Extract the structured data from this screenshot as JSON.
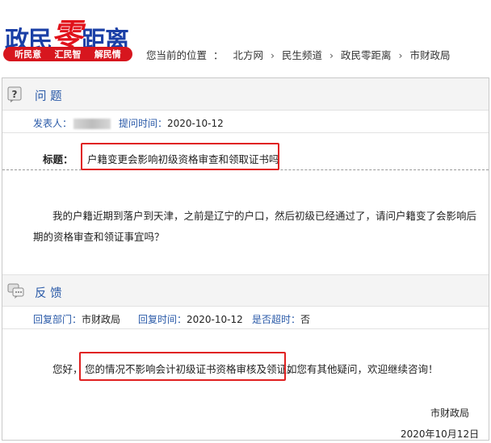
{
  "brand": {
    "logo_main_left": "政民",
    "logo_main_zero": "零",
    "logo_main_right": "距离",
    "tagline_items": [
      "听民意",
      "汇民智",
      "解民情"
    ]
  },
  "breadcrumb": {
    "label": "您当前的位置",
    "colon": "：",
    "items": [
      "北方网",
      "民生频道",
      "政民零距离",
      "市财政局"
    ],
    "separator": "›"
  },
  "question": {
    "section_title": "问 题",
    "section_icon": "question-mark-icon",
    "asker_label": "发表人：",
    "time_label": "提问时间：",
    "time_value": "2020-10-12",
    "title_label": "标题：",
    "title_text": "户籍变更会影响初级资格审查和领取证书吗",
    "body_line1": "我的户籍近期到落户到天津，之前是辽宁的户口，然后初级已经通过了，请问户籍变了会影响后",
    "body_line2": "期的资格审查和领证事宜吗？"
  },
  "reply": {
    "section_title": "反 馈",
    "section_icon": "speech-bubble-icon",
    "dept_label": "回复部门：",
    "dept_value": "市财政局",
    "time_label": "回复时间：",
    "time_value": "2020-10-12",
    "overtime_label": "是否超时：",
    "overtime_value": "否",
    "body_prefix": "您好，",
    "body_highlight": "您的情况不影响会计初级证书资格审核及领证。",
    "body_suffix": "如您有其他疑问，欢迎继续咨询！",
    "signature": "市财政局",
    "signature_date": "2020年10月12日"
  },
  "colors": {
    "brand_blue": "#1a3fa6",
    "brand_red": "#e1121b",
    "link_blue": "#2a5aa8",
    "highlight_border": "#e02020"
  }
}
